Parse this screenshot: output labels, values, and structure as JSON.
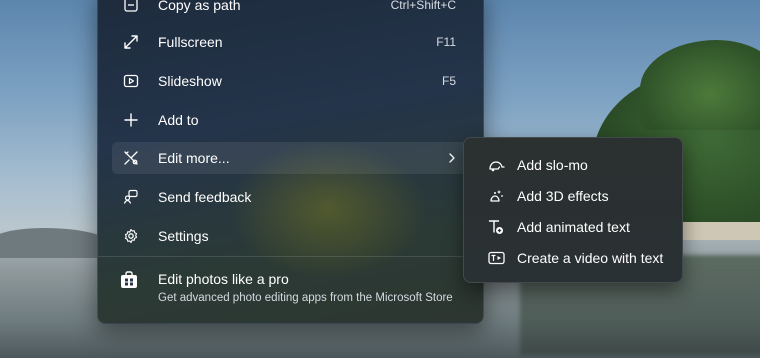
{
  "menu": {
    "items": [
      {
        "label": "Copy as path",
        "shortcut": "Ctrl+Shift+C",
        "icon": "copy-path-icon"
      },
      {
        "label": "Fullscreen",
        "shortcut": "F11",
        "icon": "fullscreen-icon"
      },
      {
        "label": "Slideshow",
        "shortcut": "F5",
        "icon": "slideshow-icon"
      },
      {
        "label": "Add to",
        "shortcut": "",
        "icon": "plus-icon"
      },
      {
        "label": "Edit more...",
        "shortcut": "",
        "icon": "edit-tools-icon"
      },
      {
        "label": "Send feedback",
        "shortcut": "",
        "icon": "feedback-icon"
      },
      {
        "label": "Settings",
        "shortcut": "",
        "icon": "gear-icon"
      }
    ],
    "promo": {
      "title": "Edit photos like a pro",
      "subtitle": "Get advanced photo editing apps from the Microsoft Store",
      "icon": "store-icon"
    }
  },
  "submenu": {
    "items": [
      {
        "label": "Add slo-mo",
        "icon": "slo-mo-icon"
      },
      {
        "label": "Add 3D effects",
        "icon": "3d-effects-icon"
      },
      {
        "label": "Add animated text",
        "icon": "animated-text-icon"
      },
      {
        "label": "Create a video with text",
        "icon": "video-text-icon"
      }
    ]
  },
  "colors": {
    "menu_background": "#24344a",
    "text": "#ffffff",
    "shortcut_text": "#d8dde3"
  }
}
